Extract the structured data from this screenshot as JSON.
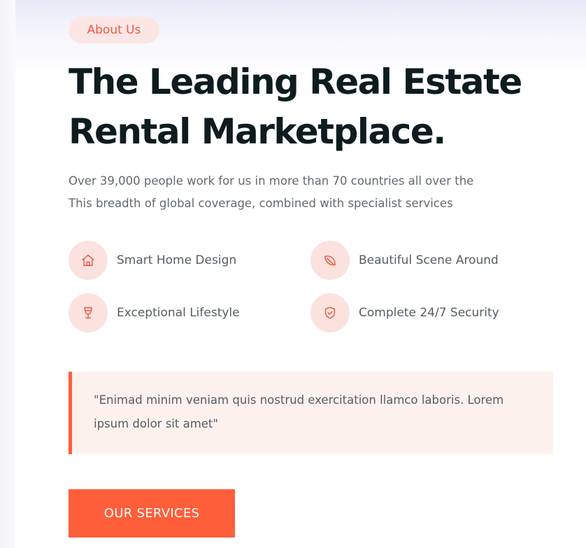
{
  "section": {
    "badge": "About Us",
    "title_line1": "The Leading Real Estate",
    "title_line2": "Rental Marketplace.",
    "description_line1": "Over 39,000 people work for us in more than 70 countries all over the",
    "description_line2": "This breadth of global coverage, combined with specialist services"
  },
  "features": [
    {
      "label": "Smart Home Design",
      "icon": "home-icon"
    },
    {
      "label": "Beautiful Scene Around",
      "icon": "leaf-icon"
    },
    {
      "label": "Exceptional Lifestyle",
      "icon": "wine-glass-icon"
    },
    {
      "label": "Complete 24/7 Security",
      "icon": "shield-check-icon"
    }
  ],
  "quote": {
    "line1": "\"Enimad minim veniam quis nostrud exercitation llamco laboris. Lorem",
    "line2": "ipsum dolor sit amet\""
  },
  "cta": {
    "label": "OUR SERVICES"
  },
  "colors": {
    "accent": "#ff5e3a",
    "badge_bg": "#fbe6e3",
    "icon_circle_bg": "#fbe2df",
    "quote_bg": "#fdf1ee",
    "heading": "#0e1c1f",
    "body_text": "#626a70"
  }
}
